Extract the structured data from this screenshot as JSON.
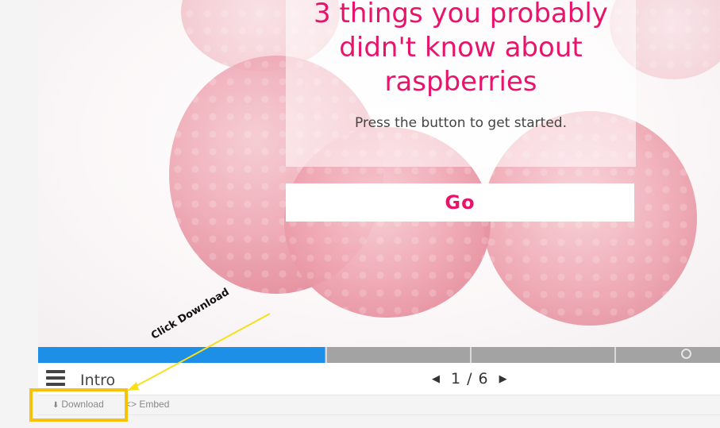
{
  "slide": {
    "title": "3 things you probably didn't know about raspberries",
    "subtitle": "Press the button to get started.",
    "go_label": "Go"
  },
  "progress": {
    "fraction": 0.42,
    "segments": 6
  },
  "controls": {
    "section_title": "Intro",
    "current_page": "1",
    "page_separator": "/",
    "total_pages": "6"
  },
  "footer": {
    "download_label": "Download",
    "embed_label": "<> Embed"
  },
  "annotation": {
    "text": "Click Download",
    "color": "#f7c10c"
  },
  "colors": {
    "accent": "#e8146b",
    "progress_fill": "#1e8fe6",
    "progress_track": "#a3a3a3"
  },
  "icons": [
    "menu-icon",
    "prev-arrow-icon",
    "next-arrow-icon",
    "download-icon",
    "end-circle-icon"
  ]
}
